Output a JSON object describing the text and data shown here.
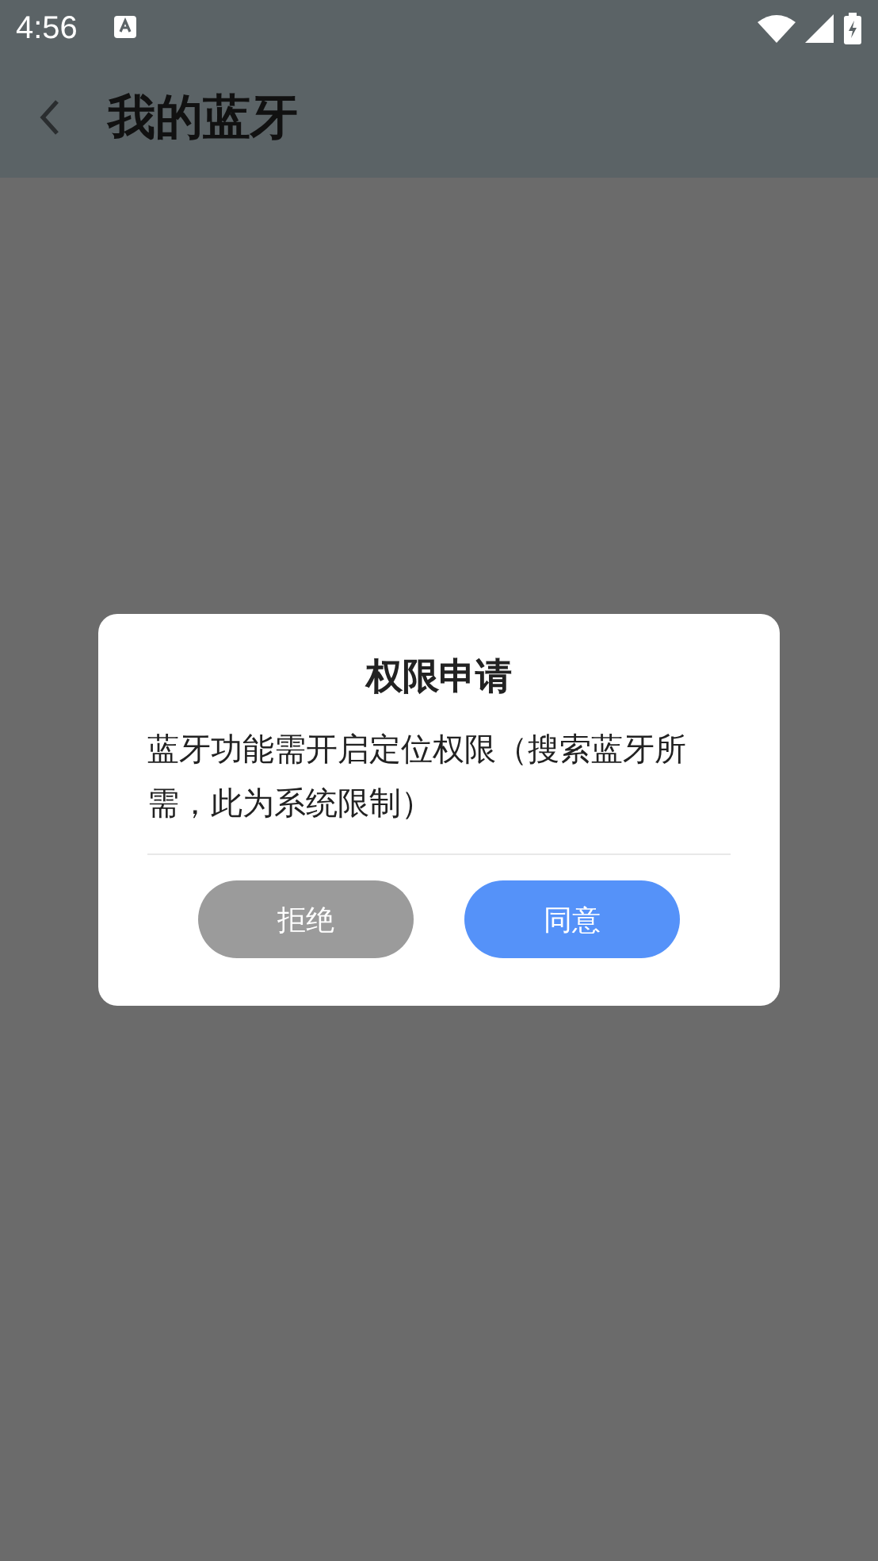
{
  "status_bar": {
    "time": "4:56"
  },
  "app_bar": {
    "title": "我的蓝牙"
  },
  "dialog": {
    "title": "权限申请",
    "message": "蓝牙功能需开启定位权限（搜索蓝牙所需，此为系统限制）",
    "buttons": [
      {
        "label": "拒绝",
        "kind": "decline"
      },
      {
        "label": "同意",
        "kind": "accept"
      }
    ]
  }
}
